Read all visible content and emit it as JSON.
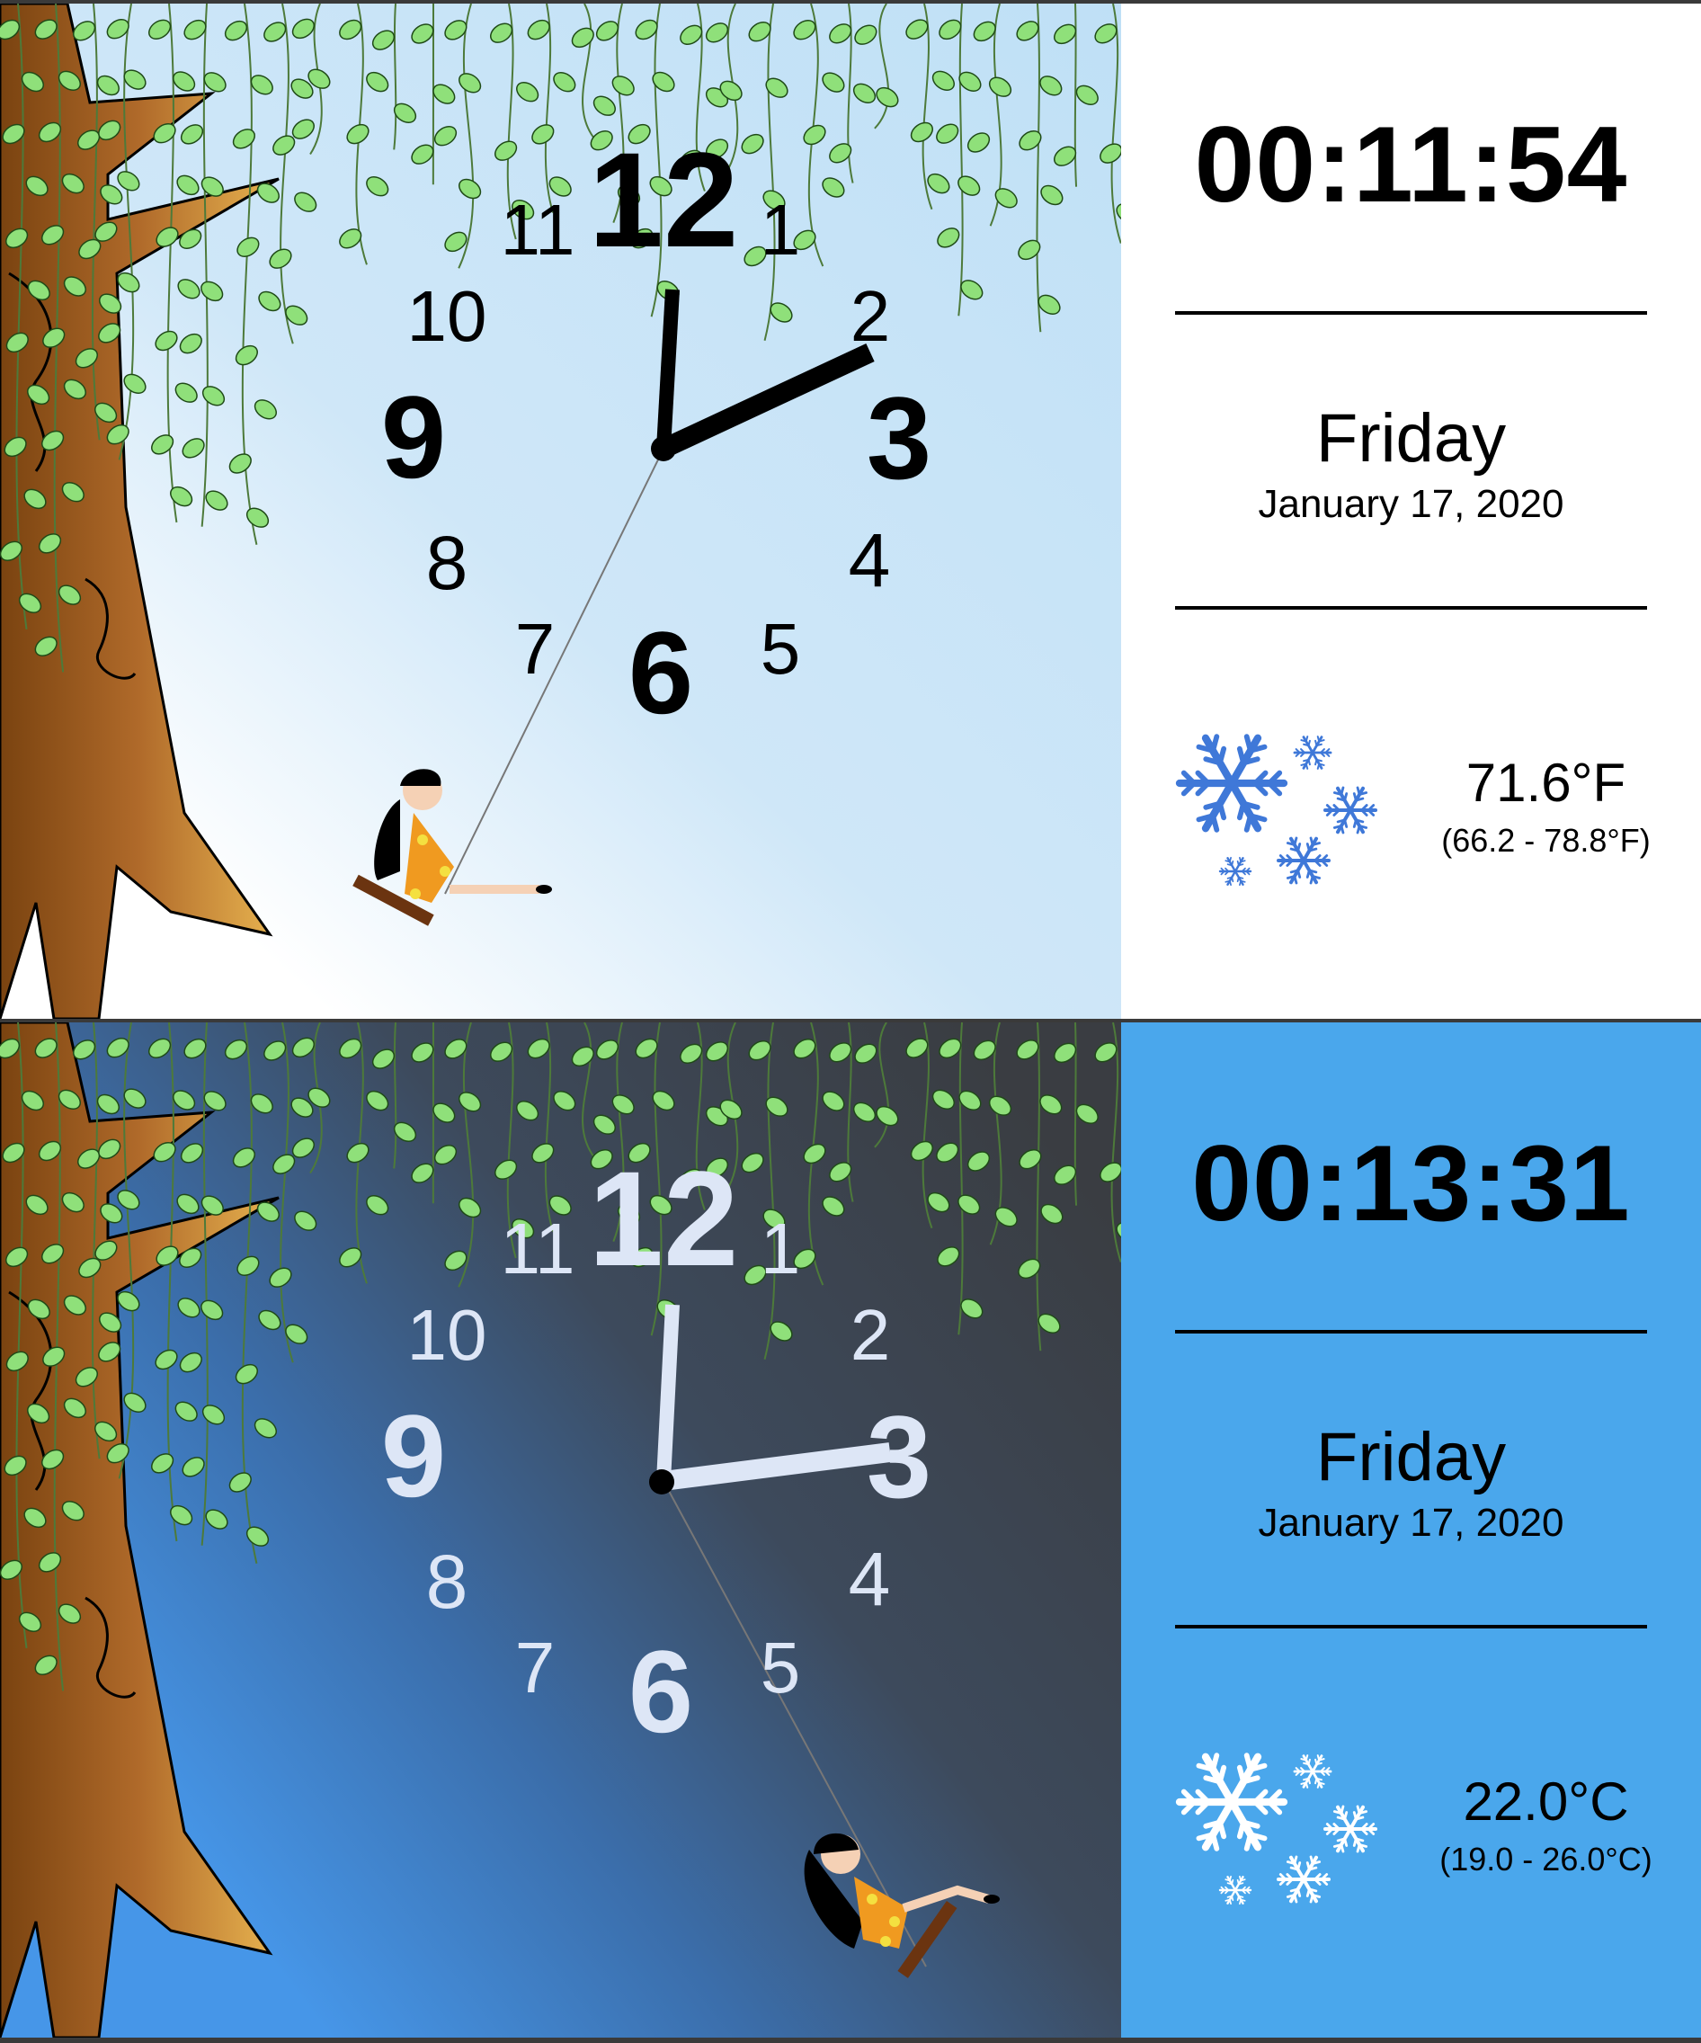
{
  "panels": [
    {
      "theme": "day",
      "time": "00:11:54",
      "weekday": "Friday",
      "date": "January 17, 2020",
      "temperature": "71.6°F",
      "range": "(66.2 - 78.8°F)",
      "weather_icon": "snowflake-icon",
      "colors": {
        "info_bg": "#ffffff",
        "numeral": "#000000",
        "hand": "#000000",
        "sky_top": "#c4e2f6",
        "sky_bottom": "#ffffff"
      }
    },
    {
      "theme": "night",
      "time": "00:13:31",
      "weekday": "Friday",
      "date": "January 17, 2020",
      "temperature": "22.0°C",
      "range": "(19.0 - 26.0°C)",
      "weather_icon": "snowflake-icon",
      "colors": {
        "info_bg": "#4aa7ec",
        "numeral": "#dde6f6",
        "hand": "#dde6f6",
        "sky_top": "#3b3f45",
        "sky_bottom": "#4a9cec"
      }
    }
  ],
  "clock_numerals": [
    "12",
    "1",
    "2",
    "3",
    "4",
    "5",
    "6",
    "7",
    "8",
    "9",
    "10",
    "11"
  ]
}
